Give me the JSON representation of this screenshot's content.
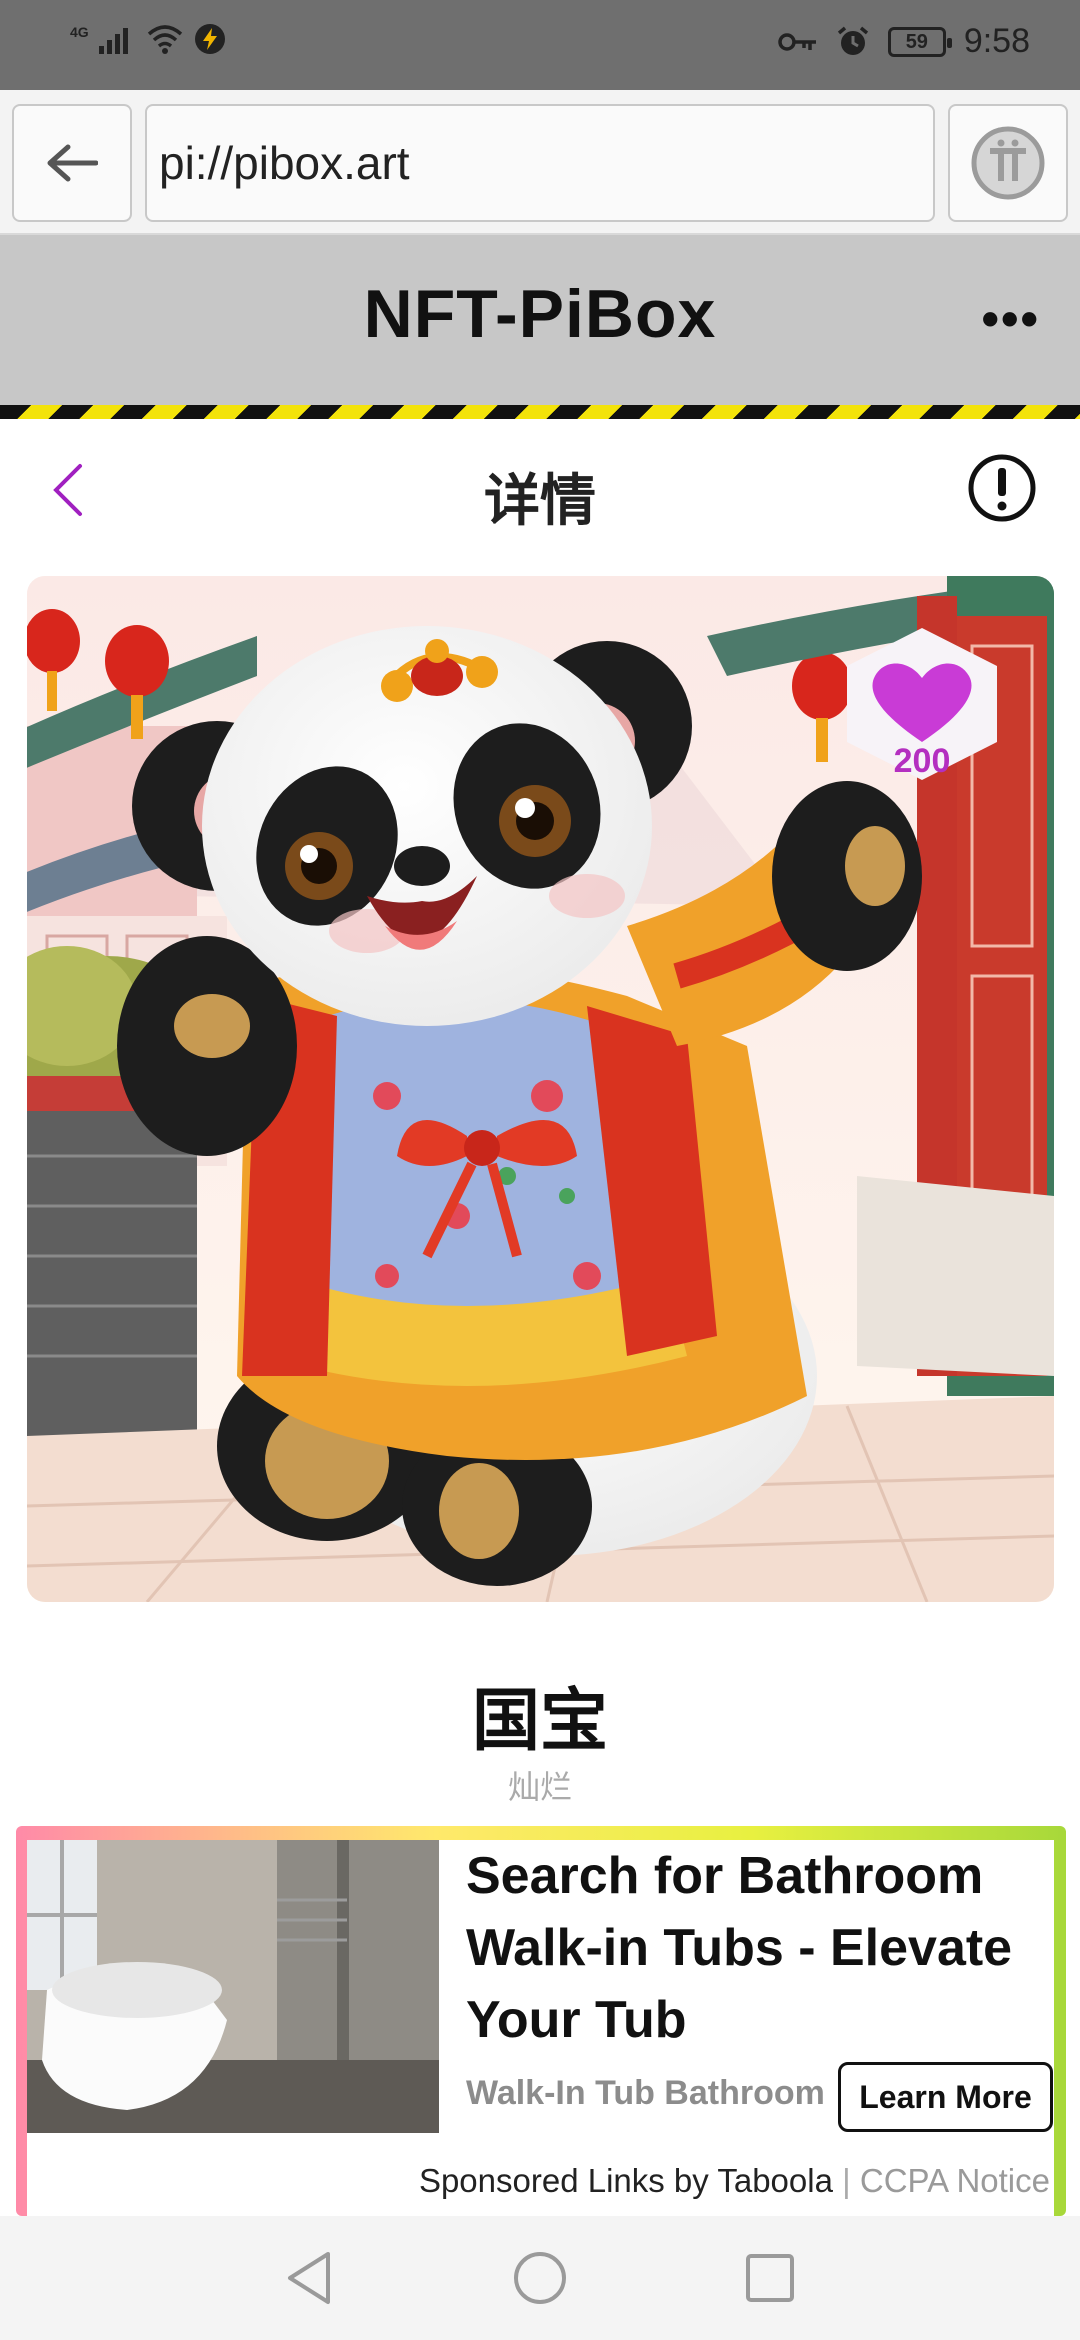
{
  "status_bar": {
    "network": "4G",
    "time": "9:58",
    "battery": "59"
  },
  "browser": {
    "url": "pi://pibox.art"
  },
  "app": {
    "title": "NFT-PiBox",
    "more_label": "•••"
  },
  "detail": {
    "title": "详情"
  },
  "nft": {
    "likes": "200",
    "name": "国宝",
    "rarity": "灿烂"
  },
  "ad": {
    "headline": "Search for Bathroom Walk-in Tubs - Elevate Your Tub",
    "source": "Walk-In Tub Bathroom",
    "cta": "Learn More",
    "footer_sponsored": "Sponsored Links by Taboola",
    "footer_separator": "|",
    "footer_ccpa": "CCPA Notice"
  },
  "colors": {
    "accent": "#a020c0",
    "like": "#c93bd6",
    "header_bg": "#c7c7c7",
    "hazard_yellow": "#f3e30a"
  }
}
